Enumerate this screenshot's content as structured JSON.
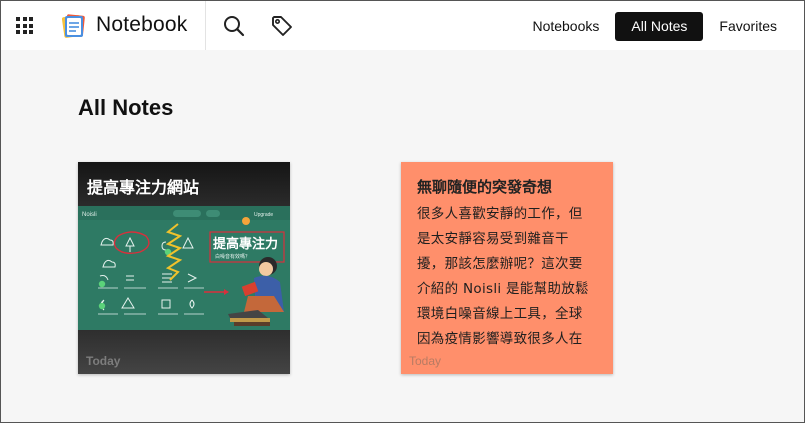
{
  "header": {
    "app_title": "Notebook",
    "nav": [
      "Notebooks",
      "All Notes",
      "Favorites"
    ],
    "active_nav": "All Notes"
  },
  "main": {
    "page_title": "All Notes",
    "notes": [
      {
        "title": "提高專注力網站",
        "date": "Today",
        "thumbnail": {
          "banner_title": "提高專注力",
          "banner_subtitle": "白噪音有效嗎？",
          "app_name": "Noisli",
          "app_label": "Upgrade"
        },
        "theme_color": "#3a3a3a"
      },
      {
        "title": "無聊隨便的突發奇想",
        "body_lines": [
          "很多人喜歡安靜的工作，但",
          "是太安靜容易受到雜音干",
          "擾，那該怎麼辦呢？這次要",
          "介紹的 Noisli 是能幫助放鬆",
          "環境白噪音線上工具，全球",
          "因為疫情影響導致很多人在"
        ],
        "date": "Today",
        "theme_color": "#ff8f6b"
      }
    ]
  },
  "colors": {
    "active_nav_bg": "#111111",
    "page_bg": "#f6f6f6",
    "thumb_bg": "#2e7a64"
  },
  "icons": [
    "apps-grid-icon",
    "notebook-logo-icon",
    "search-icon",
    "tag-icon"
  ]
}
